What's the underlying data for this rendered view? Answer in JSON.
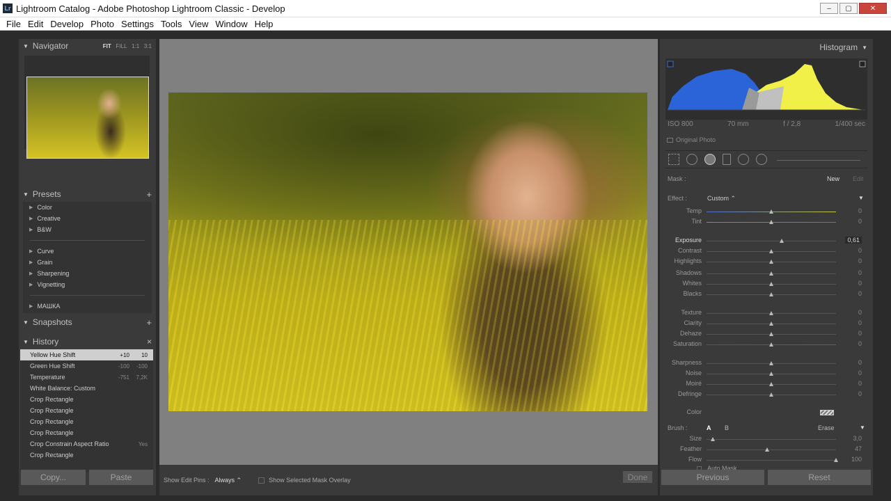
{
  "window": {
    "title": "Lightroom Catalog - Adobe Photoshop Lightroom Classic - Develop",
    "icon_text": "Lr",
    "min": "–",
    "max": "▢",
    "close": "✕"
  },
  "menu": [
    "File",
    "Edit",
    "Develop",
    "Photo",
    "Settings",
    "Tools",
    "View",
    "Window",
    "Help"
  ],
  "navigator": {
    "title": "Navigator",
    "opts": [
      "FIT",
      "FILL",
      "1:1",
      "3:1"
    ]
  },
  "presets": {
    "title": "Presets",
    "add": "+",
    "groups": [
      "Color",
      "Creative",
      "B&W",
      "Curve",
      "Grain",
      "Sharpening",
      "Vignetting",
      "МАШКА"
    ]
  },
  "snapshots": {
    "title": "Snapshots",
    "add": "+"
  },
  "history": {
    "title": "History",
    "clear": "×",
    "items": [
      {
        "name": "Yellow Hue Shift",
        "v1": "+10",
        "v2": "10"
      },
      {
        "name": "Green Hue Shift",
        "v1": "-100",
        "v2": "-100"
      },
      {
        "name": "Temperature",
        "v1": "-751",
        "v2": "7,2K"
      },
      {
        "name": "White Balance: Custom",
        "v1": "",
        "v2": ""
      },
      {
        "name": "Crop Rectangle",
        "v1": "",
        "v2": ""
      },
      {
        "name": "Crop Rectangle",
        "v1": "",
        "v2": ""
      },
      {
        "name": "Crop Rectangle",
        "v1": "",
        "v2": ""
      },
      {
        "name": "Crop Rectangle",
        "v1": "",
        "v2": ""
      },
      {
        "name": "Crop Constrain Aspect Ratio",
        "v1": "",
        "v2": "Yes"
      },
      {
        "name": "Crop Rectangle",
        "v1": "",
        "v2": ""
      }
    ]
  },
  "left_buttons": {
    "copy": "Copy...",
    "paste": "Paste"
  },
  "toolbar": {
    "show_pins_label": "Show Edit Pins :",
    "show_pins_value": "Always ⌃",
    "overlay_label": "Show Selected Mask Overlay",
    "done": "Done"
  },
  "histogram": {
    "title": "Histogram",
    "iso": "ISO 800",
    "focal": "70 mm",
    "aperture": "f / 2,8",
    "shutter": "1/400 sec",
    "original": "Original Photo"
  },
  "mask": {
    "label": "Mask :",
    "new": "New",
    "edit": "Edit"
  },
  "effect": {
    "label": "Effect :",
    "value": "Custom ⌃"
  },
  "sliders": [
    {
      "label": "Temp",
      "value": "0",
      "pos": 0.5
    },
    {
      "label": "Tint",
      "value": "0",
      "pos": 0.5
    },
    {
      "label": "Exposure",
      "value": "0,61",
      "pos": 0.58
    },
    {
      "label": "Contrast",
      "value": "0",
      "pos": 0.5
    },
    {
      "label": "Highlights",
      "value": "0",
      "pos": 0.5
    },
    {
      "label": "Shadows",
      "value": "0",
      "pos": 0.5
    },
    {
      "label": "Whites",
      "value": "0",
      "pos": 0.5
    },
    {
      "label": "Blacks",
      "value": "0",
      "pos": 0.5
    },
    {
      "label": "Texture",
      "value": "0",
      "pos": 0.5
    },
    {
      "label": "Clarity",
      "value": "0",
      "pos": 0.5
    },
    {
      "label": "Dehaze",
      "value": "0",
      "pos": 0.5
    },
    {
      "label": "Saturation",
      "value": "0",
      "pos": 0.5
    },
    {
      "label": "Sharpness",
      "value": "0",
      "pos": 0.5
    },
    {
      "label": "Noise",
      "value": "0",
      "pos": 0.5
    },
    {
      "label": "Moiré",
      "value": "0",
      "pos": 0.5
    },
    {
      "label": "Defringe",
      "value": "0",
      "pos": 0.5
    }
  ],
  "color_label": "Color",
  "brush": {
    "label": "Brush :",
    "a": "A",
    "b": "B",
    "erase": "Erase",
    "sliders": [
      {
        "label": "Size",
        "value": "3,0",
        "pos": 0.05
      },
      {
        "label": "Feather",
        "value": "47",
        "pos": 0.47
      },
      {
        "label": "Flow",
        "value": "100",
        "pos": 1.0
      }
    ],
    "auto_mask": "Auto Mask"
  },
  "right_buttons": {
    "previous": "Previous",
    "reset": "Reset"
  }
}
